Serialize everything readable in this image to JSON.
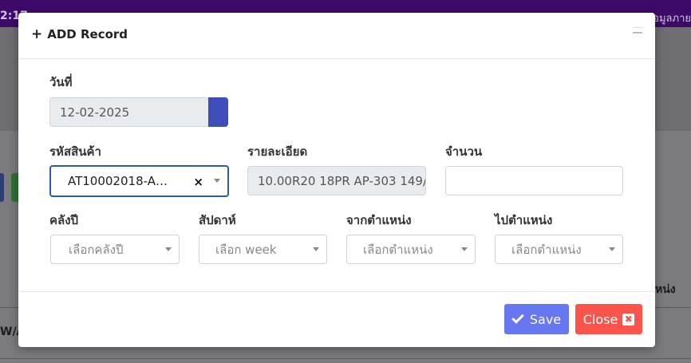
{
  "background": {
    "time_fragment": "2:17",
    "topright_fragment": "ข้อมูลภาย",
    "table_header_fragment": "หน่ง",
    "row_fragment": "W/A"
  },
  "modal": {
    "title": "ADD Record",
    "date": {
      "label": "วันที่",
      "value": "12-02-2025"
    },
    "product_code": {
      "label": "รหัสสินค้า",
      "value": "AT10002018-A…",
      "clear": "×"
    },
    "description": {
      "label": "รายละเอียด",
      "value": "10.00R20 18PR AP-303 149/"
    },
    "quantity": {
      "label": "จำนวน",
      "value": ""
    },
    "warehouse_year": {
      "label": "คลังปี",
      "placeholder": "เลือกคลังปี"
    },
    "week": {
      "label": "สัปดาห์",
      "placeholder": "เลือก week"
    },
    "from_location": {
      "label": "จากตำแหน่ง",
      "placeholder": "เลือกตำแหน่ง"
    },
    "to_location": {
      "label": "ไปตำแหน่ง",
      "placeholder": "เลือกตำแหน่ง"
    },
    "buttons": {
      "save": "Save",
      "close": "Close",
      "close_icon": "✖"
    }
  },
  "colors": {
    "save": "#6777ef",
    "close": "#fc544b",
    "date_addon": "#3f4db8",
    "topbar": "#3d0a6a"
  }
}
